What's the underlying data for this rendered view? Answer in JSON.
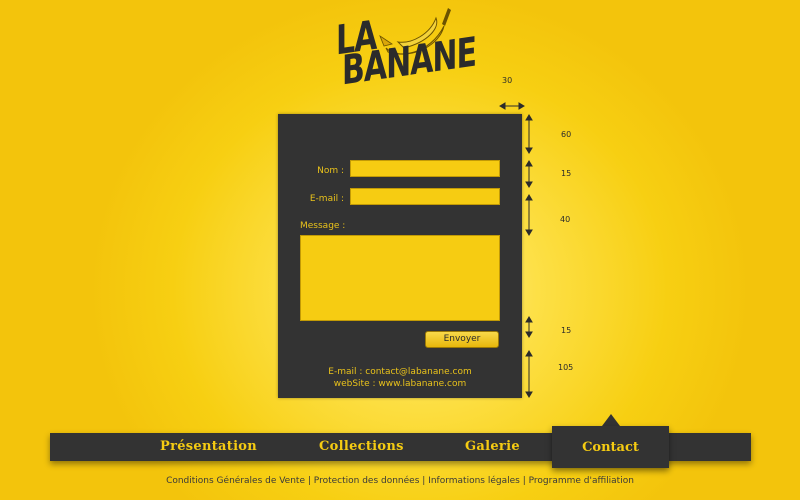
{
  "logo": {
    "line1": "LA",
    "line2": "BANANE"
  },
  "form": {
    "name_label": "Nom :",
    "email_label": "E-mail :",
    "message_label": "Message :",
    "submit_label": "Envoyer"
  },
  "contact_info": {
    "email": "E-mail : contact@labanane.com",
    "website": "webSite : www.labanane.com"
  },
  "dimensions": {
    "width": "30",
    "top": "60",
    "field_gap": "15",
    "message_gap": "40",
    "button_gap": "15",
    "bottom": "105"
  },
  "nav": {
    "items": [
      "Présentation",
      "Collections",
      "Galerie",
      "Contact"
    ],
    "active": "Contact"
  },
  "footer": {
    "links": [
      "Conditions Générales de Vente",
      "Protection des données",
      "Informations légales",
      "Programme d'affiliation"
    ],
    "separator": "|"
  },
  "colors": {
    "background": "#f7cf12",
    "panel": "#333333",
    "accent": "#f6cc12"
  }
}
